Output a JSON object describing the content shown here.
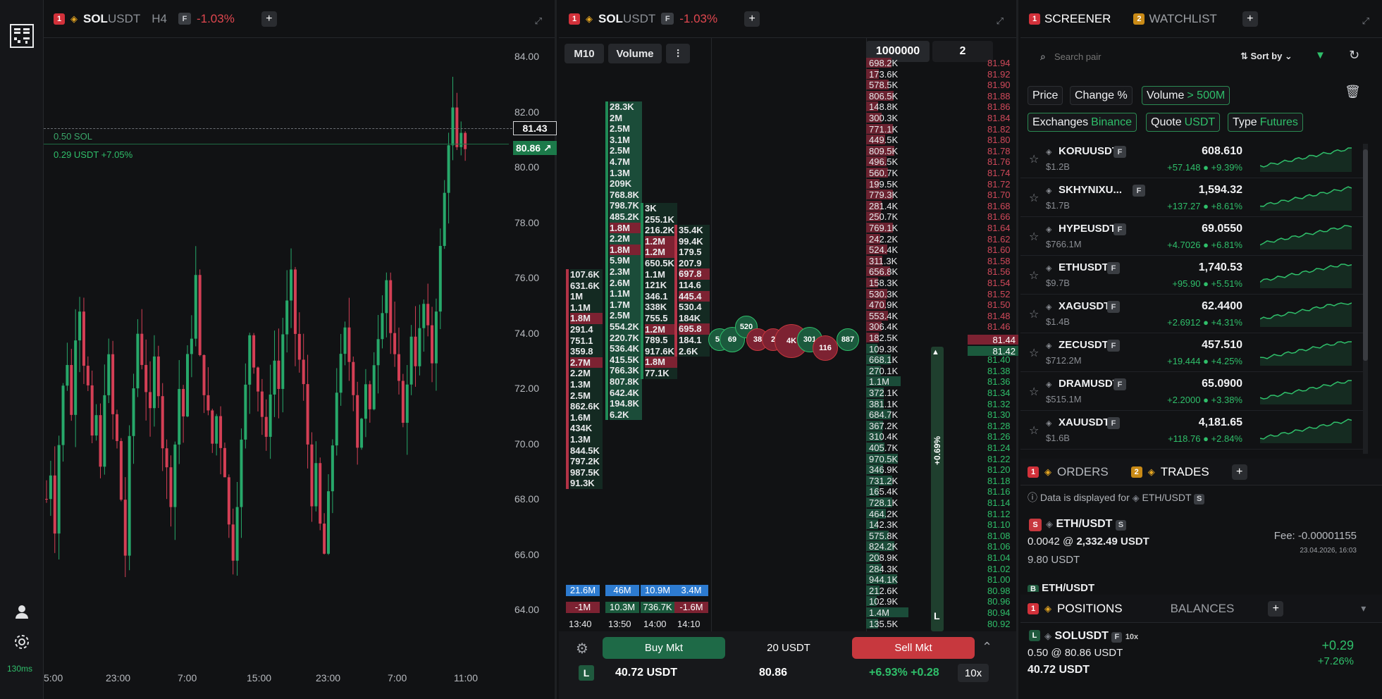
{
  "rail": {
    "latency": "130ms",
    "icons": [
      "app-logo",
      "user-icon",
      "gear-icon"
    ]
  },
  "chart_panel": {
    "tab_num": "1",
    "symbol_base": "SOL",
    "symbol_quote": "USDT",
    "interval": "H4",
    "type_badge": "F",
    "change": "-1.03%",
    "position_line_label": "0.50 SOL",
    "pnl_label": "0.29 USDT  +7.05%",
    "cursor_price": "81.43",
    "last_price": "80.86",
    "price_ticks": [
      "84.00",
      "82.00",
      "80.00",
      "78.00",
      "76.00",
      "74.00",
      "72.00",
      "70.00",
      "68.00",
      "66.00",
      "64.00"
    ],
    "time_ticks": [
      "5:00",
      "23:00",
      "7:00",
      "15:00",
      "23:00",
      "7:00",
      "11:00"
    ]
  },
  "flow_panel": {
    "tab_num": "1",
    "symbol_base": "SOL",
    "symbol_quote": "USDT",
    "type_badge": "F",
    "change": "-1.03%",
    "tf_button": "M10",
    "volume_button": "Volume",
    "ladder_size": "1000000",
    "ladder_step": "2",
    "col_totals_top": [
      "21.6M",
      "46M",
      "10.9M",
      "3.4M"
    ],
    "col_totals_bottom": [
      "-1M",
      "10.3M",
      "736.7K",
      "-1.6M"
    ],
    "col_times": [
      "13:40",
      "13:50",
      "14:00",
      "14:10"
    ],
    "percent_tag": "+0.69%",
    "buy_label": "Buy Mkt",
    "sell_label": "Sell Mkt",
    "order_amount": "20 USDT",
    "pos_side": "L",
    "pos_value": "40.72 USDT",
    "pos_entry": "80.86",
    "pos_pnl": "+6.93% +0.28",
    "leverage": "10x",
    "bubbles": [
      "54",
      "69",
      "520",
      "38",
      "2",
      "4K",
      "301",
      "116",
      "887"
    ]
  },
  "right_panel": {
    "tab1_num": "1",
    "tab1": "SCREENER",
    "tab2_num": "2",
    "tab2": "WATCHLIST",
    "search_placeholder": "Search pair",
    "sort_label": "Sort by",
    "filters": {
      "price": "Price",
      "change": "Change %",
      "volume": "Volume",
      "volume_value": "> 500M",
      "exchanges": "Exchanges",
      "exchanges_value": "Binance",
      "quote": "Quote",
      "quote_value": "USDT",
      "type": "Type",
      "type_value": "Futures"
    },
    "rows": [
      {
        "name": "KORUUSDT",
        "vol": "$1.2B",
        "price": "608.610",
        "chg": "+57.148 ● +9.39%"
      },
      {
        "name": "SKHYNIXU...",
        "vol": "$1.7B",
        "price": "1,594.32",
        "chg": "+137.27 ● +8.61%"
      },
      {
        "name": "HYPEUSDT",
        "vol": "$766.1M",
        "price": "69.0550",
        "chg": "+4.7026 ● +6.81%"
      },
      {
        "name": "ETHUSDT",
        "vol": "$9.7B",
        "price": "1,740.53",
        "chg": "+95.90 ● +5.51%"
      },
      {
        "name": "XAGUSDT",
        "vol": "$1.4B",
        "price": "62.4400",
        "chg": "+2.6912 ● +4.31%"
      },
      {
        "name": "ZECUSDT",
        "vol": "$712.2M",
        "price": "457.510",
        "chg": "+19.444 ● +4.25%"
      },
      {
        "name": "DRAMUSDT",
        "vol": "$515.1M",
        "price": "65.0900",
        "chg": "+2.2000 ● +3.38%"
      },
      {
        "name": "XAUUSDT",
        "vol": "$1.6B",
        "price": "4,181.65",
        "chg": "+118.76 ● +2.84%"
      }
    ],
    "orders": {
      "tab1_num": "1",
      "tab1": "ORDERS",
      "tab2_num": "2",
      "tab2": "TRADES",
      "info": "Data is displayed for",
      "info_pair": "ETH/USDT",
      "info_badge": "S",
      "trade_side": "S",
      "trade_pair": "ETH/USDT",
      "trade_badge": "S",
      "trade_qty": "0.0042 @",
      "trade_price": "2,332.49 USDT",
      "trade_total": "9.80 USDT",
      "fee": "Fee: -0.00001155",
      "trade_time": "23.04.2026, 16:03",
      "next_side": "B",
      "next_pair": "ETH/USDT"
    },
    "positions": {
      "tab_num": "1",
      "tab1": "POSITIONS",
      "tab2": "BALANCES",
      "side": "L",
      "pair": "SOLUSDT",
      "badge": "F",
      "lev": "10x",
      "detail": "0.50 @ 80.86 USDT",
      "value": "40.72 USDT",
      "pnl": "+0.29",
      "pnl_pct": "+7.26%"
    }
  }
}
